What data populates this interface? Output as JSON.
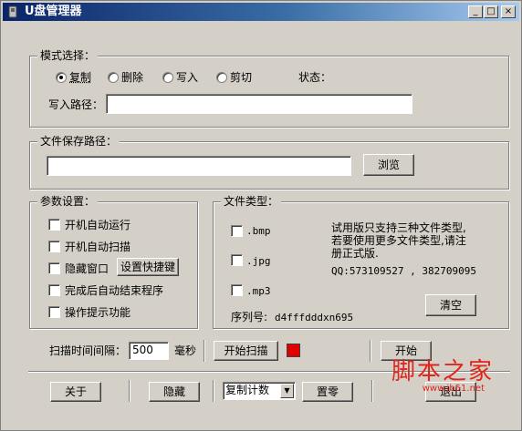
{
  "window": {
    "title": "U盘管理器",
    "controls": {
      "minimize": "_",
      "maximize": "□",
      "close": "×"
    }
  },
  "mode": {
    "legend": "模式选择：",
    "options": [
      "复制",
      "删除",
      "写入",
      "剪切"
    ],
    "selected": "复制",
    "status_label": "状态：",
    "write_path_label": "写入路径：",
    "write_path_value": ""
  },
  "save": {
    "legend": "文件保存路径：",
    "path_value": "",
    "browse": "浏览"
  },
  "params": {
    "legend": "参数设置：",
    "items": [
      "开机自动运行",
      "开机自动扫描",
      "隐藏窗口",
      "完成后自动结束程序",
      "操作提示功能"
    ],
    "hotkey_button": "设置快捷键"
  },
  "filetypes": {
    "legend": "文件类型：",
    "items": [
      ".bmp",
      ".jpg",
      ".mp3"
    ],
    "note_lines": [
      "试用版只支持三种文件类型,",
      "若要使用更多文件类型,请注",
      "册正式版."
    ],
    "qq": "QQ:573109527 , 382709095",
    "serial_label": "序列号:",
    "serial_value": "d4fffdddxn695",
    "clear": "清空"
  },
  "scan": {
    "interval_label": "扫描时间间隔：",
    "interval_value": "500",
    "unit": "毫秒",
    "start_scan": "开始扫描",
    "indicator_color": "#e00000",
    "start": "开始"
  },
  "bottom": {
    "about": "关于",
    "hide": "隐藏",
    "counter_selected": "复制计数",
    "reset": "置零",
    "exit": "退出"
  },
  "watermark": {
    "text": "脚本之家",
    "url": "www.jb51.net"
  },
  "colors": {
    "face": "#d4d0c8",
    "title_start": "#0a246a",
    "title_end": "#a6caf0",
    "indicator": "#e00000"
  }
}
